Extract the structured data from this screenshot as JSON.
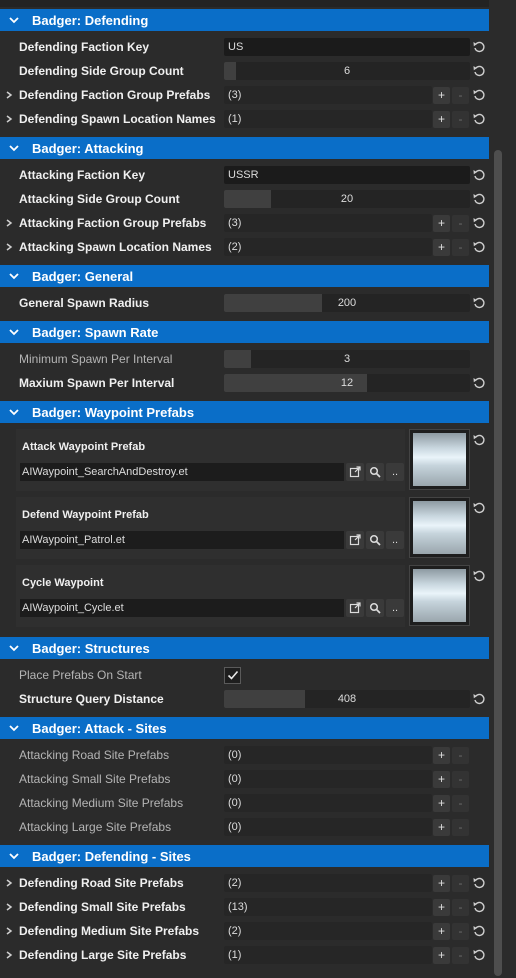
{
  "sections": {
    "defending": {
      "title": "Badger: Defending"
    },
    "attacking": {
      "title": "Badger: Attacking"
    },
    "general": {
      "title": "Badger: General"
    },
    "spawn_rate": {
      "title": "Badger: Spawn Rate"
    },
    "waypoint_prefabs": {
      "title": "Badger: Waypoint Prefabs"
    },
    "structures": {
      "title": "Badger: Structures"
    },
    "attack_sites": {
      "title": "Badger: Attack - Sites"
    },
    "defending_sites": {
      "title": "Badger: Defending - Sites"
    }
  },
  "defending": {
    "faction_key": {
      "label": "Defending Faction Key",
      "value": "US"
    },
    "side_group_count": {
      "label": "Defending Side Group Count",
      "value": "6",
      "fill": 0.05
    },
    "faction_group_prefabs": {
      "label": "Defending Faction Group Prefabs",
      "value": "(3)"
    },
    "spawn_location_names": {
      "label": "Defending Spawn Location Names",
      "value": "(1)"
    }
  },
  "attacking": {
    "faction_key": {
      "label": "Attacking Faction Key",
      "value": "USSR"
    },
    "side_group_count": {
      "label": "Attacking Side Group Count",
      "value": "20",
      "fill": 0.19
    },
    "faction_group_prefabs": {
      "label": "Attacking Faction Group Prefabs",
      "value": "(3)"
    },
    "spawn_location_names": {
      "label": "Attacking Spawn Location Names",
      "value": "(2)"
    }
  },
  "general": {
    "spawn_radius": {
      "label": "General Spawn Radius",
      "value": "200",
      "fill": 0.4
    }
  },
  "spawn_rate": {
    "minimum": {
      "label": "Minimum Spawn Per Interval",
      "value": "3",
      "fill": 0.11
    },
    "maximum": {
      "label": "Maxium Spawn Per Interval",
      "value": "12",
      "fill": 0.58
    }
  },
  "waypoints": {
    "attack": {
      "label": "Attack Waypoint Prefab",
      "path": "AIWaypoint_SearchAndDestroy.et"
    },
    "defend": {
      "label": "Defend Waypoint Prefab",
      "path": "AIWaypoint_Patrol.et"
    },
    "cycle": {
      "label": "Cycle Waypoint",
      "path": "AIWaypoint_Cycle.et"
    },
    "browse_label": ".."
  },
  "structures": {
    "place_on_start": {
      "label": "Place Prefabs On Start",
      "checked": true
    },
    "query_distance": {
      "label": "Structure Query Distance",
      "value": "408",
      "fill": 0.33
    }
  },
  "attack_sites": {
    "road": {
      "label": "Attacking Road Site Prefabs",
      "value": "(0)"
    },
    "small": {
      "label": "Attacking Small Site Prefabs",
      "value": "(0)"
    },
    "medium": {
      "label": "Attacking Medium Site Prefabs",
      "value": "(0)"
    },
    "large": {
      "label": "Attacking Large Site Prefabs",
      "value": "(0)"
    }
  },
  "defending_sites": {
    "road": {
      "label": "Defending Road Site Prefabs",
      "value": "(2)"
    },
    "small": {
      "label": "Defending Small Site Prefabs",
      "value": "(13)"
    },
    "medium": {
      "label": "Defending Medium Site Prefabs",
      "value": "(2)"
    },
    "large": {
      "label": "Defending Large Site Prefabs",
      "value": "(1)"
    }
  },
  "buttons": {
    "add": "+",
    "remove": "-"
  },
  "colors": {
    "header": "#0a6ec8",
    "background": "#2b2b2b",
    "field": "#1f1f1f"
  }
}
